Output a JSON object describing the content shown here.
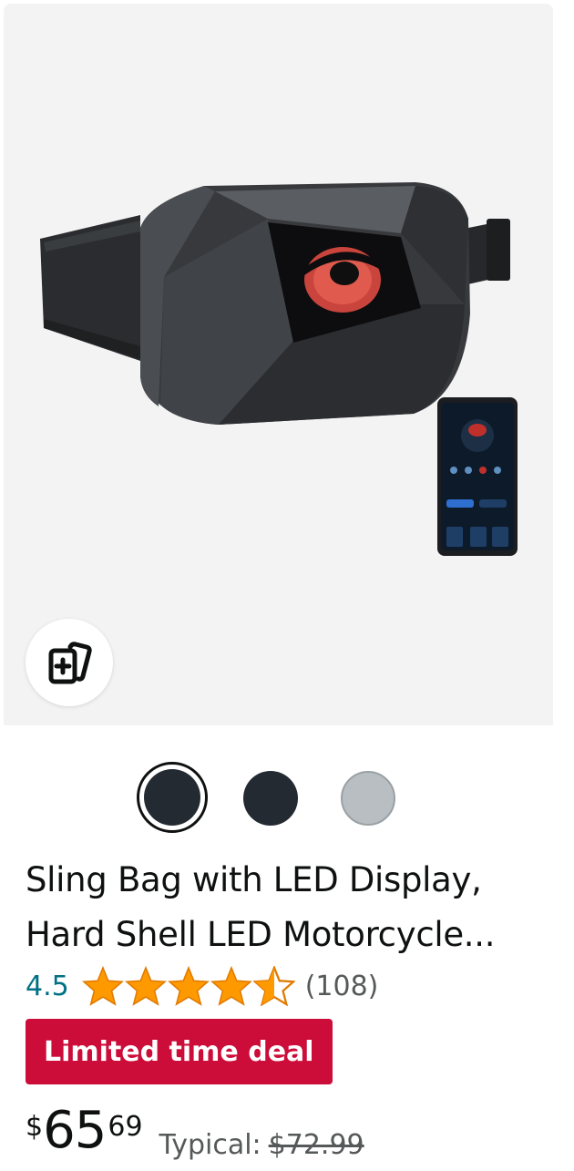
{
  "product": {
    "image_alt": "Sling bag with LED display and smartphone app",
    "title": "Sling Bag with LED Display, Hard Shell LED Motorcycle...",
    "rating": "4.5",
    "stars_fraction": 0.9,
    "review_count": "(108)",
    "deal_label": "Limited time deal",
    "price": {
      "symbol": "$",
      "whole": "65",
      "fraction": "69",
      "typical_label": "Typical:",
      "typical_price": "$72.99"
    },
    "swatches": [
      {
        "name": "Black",
        "color": "#232a31",
        "selected": true
      },
      {
        "name": "Black",
        "color": "#232a31",
        "selected": false
      },
      {
        "name": "Gray",
        "color": "#b8bec2",
        "selected": false
      }
    ]
  },
  "icons": {
    "compare": "compare-cards-icon",
    "star_full": "star-full-icon",
    "star_half": "star-half-icon"
  },
  "colors": {
    "star": "#ff9900",
    "link": "#007185",
    "deal": "#cc0c39"
  }
}
